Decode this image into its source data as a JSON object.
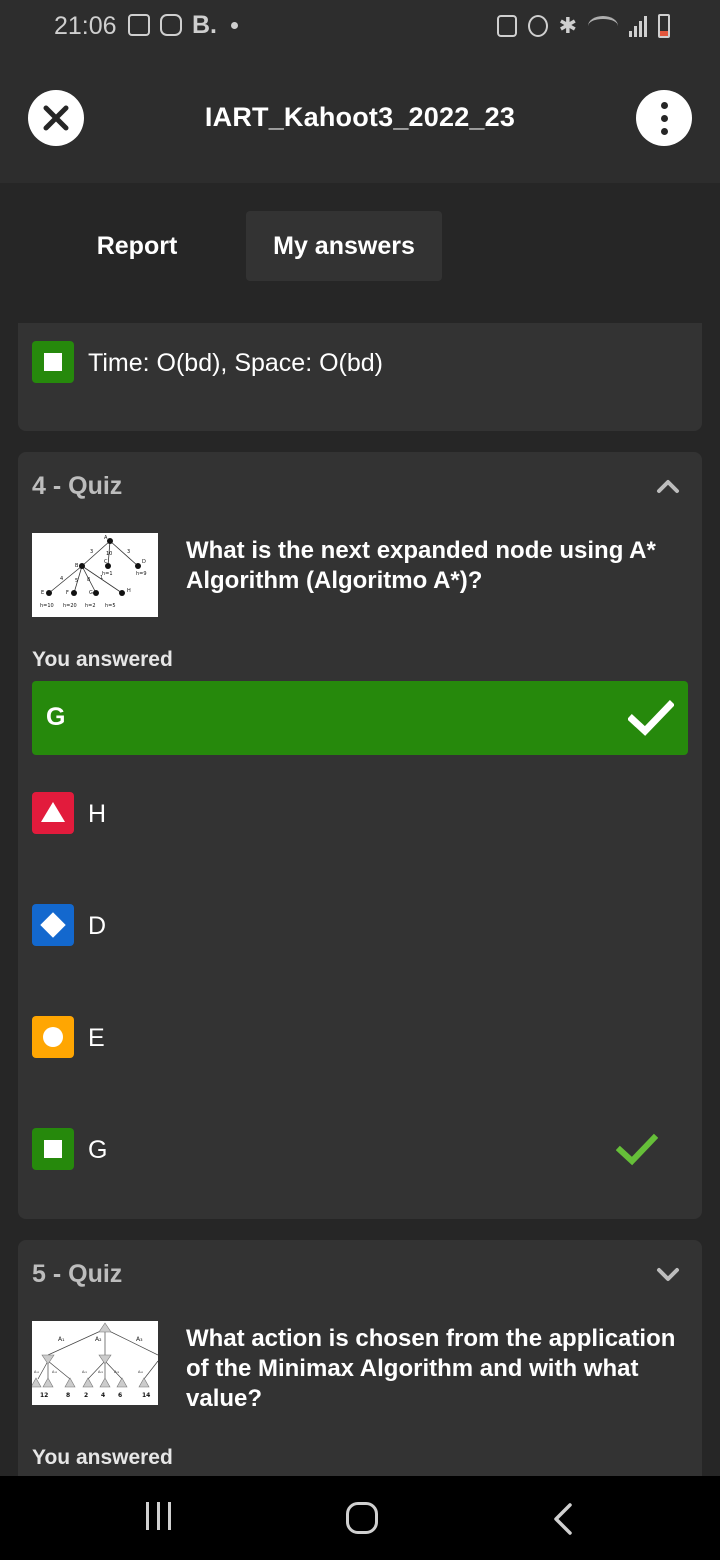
{
  "status_bar": {
    "time": "21:06",
    "app_letter": "B."
  },
  "header": {
    "title": "IART_Kahoot3_2022_23"
  },
  "tabs": {
    "report": "Report",
    "my_answers": "My answers"
  },
  "prev_card": {
    "option_text": "Time: O(bd), Space: O(bd)"
  },
  "quiz4": {
    "label": "4 - Quiz",
    "question": "What is the next expanded node using A* Algorithm (Algoritmo A*)?",
    "you_answered": "You answered",
    "answer": "G",
    "options": [
      {
        "shape": "triangle",
        "color": "#e21b3c",
        "text": "H"
      },
      {
        "shape": "diamond",
        "color": "#1368ce",
        "text": "D"
      },
      {
        "shape": "circle",
        "color": "#ffa602",
        "text": "E"
      },
      {
        "shape": "square",
        "color": "#26890c",
        "text": "G"
      }
    ],
    "diagram": {
      "nodes": [
        "A",
        "B",
        "C",
        "D",
        "E",
        "F",
        "G",
        "H"
      ],
      "edge_costs": [
        "3",
        "10",
        "3",
        "4",
        "5",
        "8",
        "1"
      ],
      "heuristics": [
        "h=1",
        "h=9",
        "h=10",
        "h=20",
        "h=2",
        "h=5"
      ]
    }
  },
  "quiz5": {
    "label": "5 - Quiz",
    "question": "What action is chosen from the application of the Minimax Algorithm and with what value?",
    "you_answered": "You answered",
    "diagram": {
      "actions": [
        "A₁",
        "A₂",
        "A₃"
      ],
      "sub_actions": [
        "A₁₁",
        "A₁₂",
        "A₂₁",
        "A₂₂",
        "A₂₃",
        "A₃₁"
      ],
      "leaf_values": [
        "12",
        "8",
        "2",
        "4",
        "6",
        "14"
      ]
    }
  },
  "colors": {
    "background": "#262626",
    "card": "#333333",
    "correct_green": "#26890c",
    "check_green": "#66bf39"
  }
}
